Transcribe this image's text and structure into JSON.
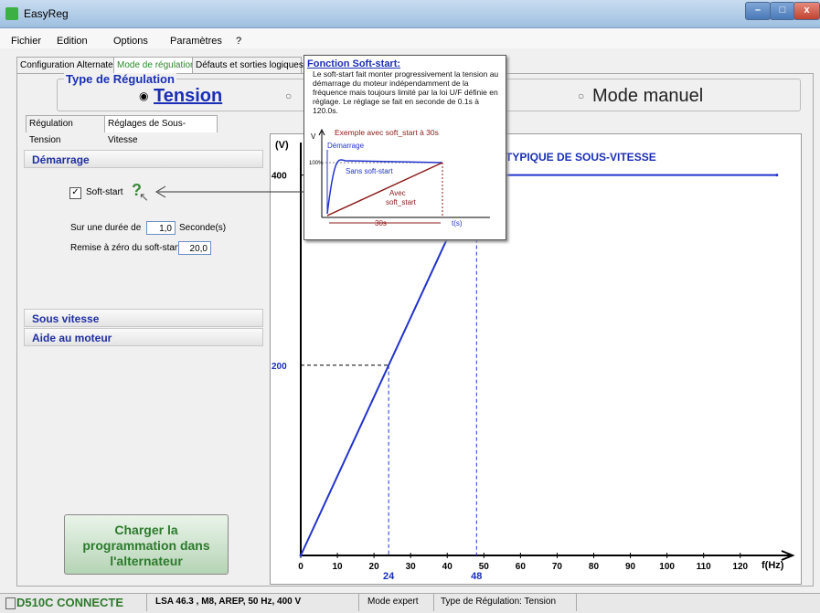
{
  "window": {
    "title": "EasyReg"
  },
  "menu": {
    "items": [
      "Fichier",
      "Edition",
      "Options",
      "Paramètres",
      "?"
    ]
  },
  "tabs_top": [
    "Configuration Alternateur",
    "Mode de régulation",
    "Défauts et sorties logiques"
  ],
  "regulation": {
    "group_title": "Type de Régulation",
    "option_tension": "Tension",
    "option_manual": "Mode manuel"
  },
  "subtabs": [
    "Régulation Tension",
    "Réglages de Sous-Vitesse"
  ],
  "sections": {
    "demarrage": "Démarrage",
    "sous_vitesse": "Sous vitesse",
    "aide_moteur": "Aide au moteur"
  },
  "softstart": {
    "checkbox_label": "Soft-start",
    "checked": true,
    "duration_label": "Sur une durée de",
    "duration_value": "1,0",
    "duration_unit": "Seconde(s)",
    "reset_label": "Remise à zéro du soft-start",
    "reset_value": "20,0"
  },
  "load_button": {
    "line1": "Charger la",
    "line2": "programmation dans",
    "line3": "l'alternateur"
  },
  "tooltip": {
    "title": "Fonction Soft-start:",
    "text": "Le soft-start fait monter progressivement la tension au démarrage du moteur indépendamment de la fréquence mais toujours limité par la loi U/F définie en réglage. Le réglage se fait en seconde de 0.1s à 120.0s.",
    "example": "Exemple avec soft_start à 30s",
    "v_label": "V",
    "demarrage": "Démarrage",
    "pct": "100%",
    "sans": "Sans soft-start",
    "avec1": "Avec",
    "avec2": "soft_start",
    "dur": "30s",
    "t": "t(s)"
  },
  "chart_data": {
    "type": "line",
    "title": "TYPIQUE DE SOUS-VITESSE",
    "ylabel": "(V)",
    "xlabel": "f(Hz)",
    "x_ticks": [
      "0",
      "10",
      "20",
      "30",
      "40",
      "50",
      "60",
      "70",
      "80",
      "90",
      "100",
      "110",
      "120"
    ],
    "y_ticks": [
      "200",
      "400"
    ],
    "xlim": [
      0,
      130
    ],
    "ylim": [
      0,
      415
    ],
    "series": [
      {
        "x": [
          0,
          48,
          130
        ],
        "y": [
          0,
          400,
          400
        ]
      }
    ],
    "guides": [
      {
        "x": 24,
        "y": 200,
        "label": "24"
      },
      {
        "x": 48,
        "y": 400,
        "label": "48"
      }
    ],
    "line_color": "#2233cc"
  },
  "status": {
    "connection": "D510C CONNECTE",
    "model": "LSA 46.3  , M8, AREP, 50 Hz, 400 V",
    "mode": "Mode expert",
    "regulation": "Type de Régulation: Tension"
  }
}
